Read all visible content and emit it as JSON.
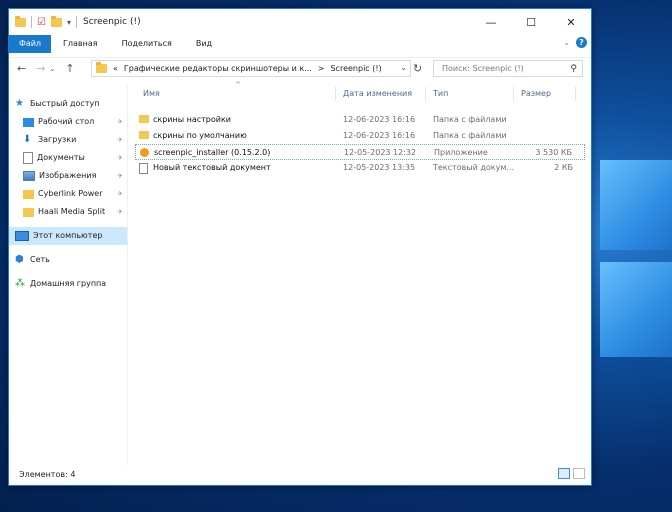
{
  "window": {
    "title": "Screenpic (!)",
    "controls": {
      "minimize": "—",
      "maximize": "☐",
      "close": "✕"
    }
  },
  "ribbon": {
    "tabs": [
      {
        "label": "Файл",
        "active": true
      },
      {
        "label": "Главная"
      },
      {
        "label": "Поделиться"
      },
      {
        "label": "Вид"
      }
    ]
  },
  "address": {
    "crumbs": [
      "«",
      "Графические редакторы скриншотеры и к...",
      ">",
      "Screenpic (!)"
    ],
    "search_placeholder": "Поиск: Screenpic (!)"
  },
  "sidebar": {
    "items": [
      {
        "label": "Быстрый доступ",
        "icon": "star-icon",
        "pinned": false
      },
      {
        "label": "Рабочий стол",
        "icon": "desktop-icon",
        "pinned": true
      },
      {
        "label": "Загрузки",
        "icon": "download-icon",
        "pinned": true
      },
      {
        "label": "Документы",
        "icon": "documents-icon",
        "pinned": true
      },
      {
        "label": "Изображения",
        "icon": "pictures-icon",
        "pinned": true
      },
      {
        "label": "Cyberlink Power",
        "icon": "folder-icon",
        "pinned": true
      },
      {
        "label": "Haali Media Split",
        "icon": "folder-icon",
        "pinned": true
      },
      {
        "label": "Этот компьютер",
        "icon": "computer-icon",
        "selected": true
      },
      {
        "label": "Сеть",
        "icon": "network-icon"
      },
      {
        "label": "Домашняя группа",
        "icon": "homegroup-icon"
      }
    ]
  },
  "columns": {
    "name": "Имя",
    "date": "Дата изменения",
    "type": "Тип",
    "size": "Размер"
  },
  "files": [
    {
      "name": "скрины настройки",
      "date": "12-06-2023 16:16",
      "type": "Папка с файлами",
      "size": "",
      "icon": "folder-icon"
    },
    {
      "name": "скрины по умолчанию",
      "date": "12-06-2023 16:16",
      "type": "Папка с файлами",
      "size": "",
      "icon": "folder-icon"
    },
    {
      "name": "screenpic_installer (0.15.2.0)",
      "date": "12-05-2023 12:32",
      "type": "Приложение",
      "size": "3 530 КБ",
      "icon": "installer-icon",
      "focused": true
    },
    {
      "name": "Новый текстовый документ",
      "date": "12-05-2023 13:35",
      "type": "Текстовый докум...",
      "size": "2 КБ",
      "icon": "text-file-icon"
    }
  ],
  "status": {
    "count": "Элементов: 4"
  },
  "colors": {
    "accent": "#1979ca",
    "selection": "#cce8ff",
    "folder": "#f4c84e"
  }
}
